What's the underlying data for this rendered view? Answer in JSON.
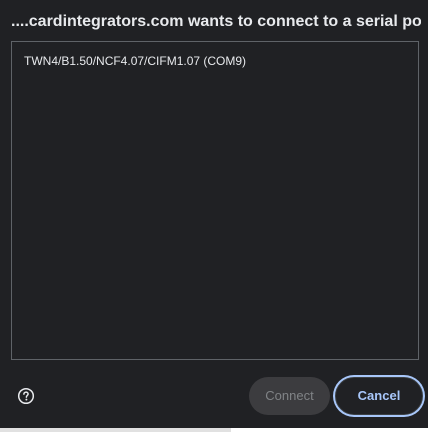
{
  "dialog": {
    "title": "....cardintegrators.com wants to connect to a serial port",
    "devices": [
      {
        "label": "TWN4/B1.50/NCF4.07/CIFM1.07 (COM9)"
      }
    ],
    "help_icon": "help-circle-icon",
    "buttons": {
      "connect_label": "Connect",
      "cancel_label": "Cancel"
    }
  },
  "colors": {
    "background": "#202124",
    "text": "#e8eaed",
    "border": "#5f6368",
    "accent": "#a8c7fa",
    "disabled_button_bg": "#3c3c3f",
    "disabled_button_text": "#808386"
  }
}
